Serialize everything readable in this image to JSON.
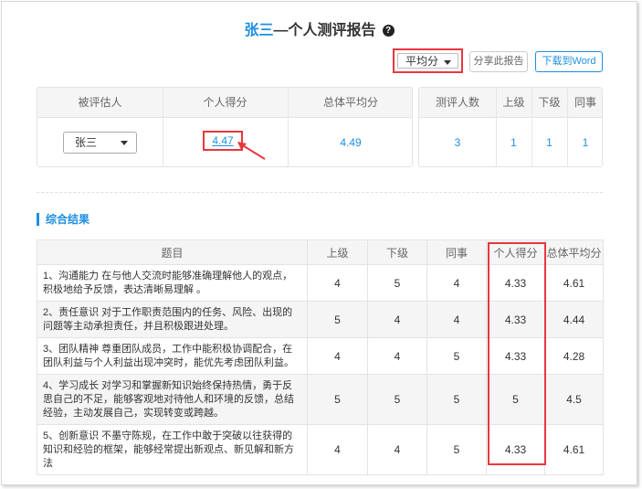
{
  "header": {
    "name": "张三",
    "title_suffix": "—个人测评报告",
    "help_icon": "question-circle-icon"
  },
  "toolbar": {
    "avg_select_value": "平均分",
    "share_label": "分享此报告",
    "download_label": "下载到Word"
  },
  "summary": {
    "headers": [
      "被评估人",
      "个人得分",
      "总体平均分"
    ],
    "person": "张三",
    "personal_score": "4.47",
    "overall_avg": "4.49"
  },
  "counts": {
    "headers": [
      "测评人数",
      "上级",
      "下级",
      "同事"
    ],
    "values": [
      "3",
      "1",
      "1",
      "1"
    ]
  },
  "results": {
    "section_title": "综合结果",
    "headers": [
      "题目",
      "上级",
      "下级",
      "同事",
      "个人得分",
      "总体平均分"
    ],
    "rows": [
      {
        "q": "1、沟通能力 在与他人交流时能够准确理解他人的观点，积极地给予反馈，表达清晰易理解 。",
        "sup": "4",
        "sub": "5",
        "peer": "4",
        "personal": "4.33",
        "avg": "4.61"
      },
      {
        "q": "2、责任意识 对于工作职责范围内的任务、风险、出现的问题等主动承担责任，并且积极跟进处理。",
        "sup": "5",
        "sub": "4",
        "peer": "4",
        "personal": "4.33",
        "avg": "4.44"
      },
      {
        "q": "3、团队精神 尊重团队成员，工作中能积极协调配合，在团队利益与个人利益出现冲突时，能优先考虑团队利益。",
        "sup": "4",
        "sub": "4",
        "peer": "5",
        "personal": "4.33",
        "avg": "4.28"
      },
      {
        "q": "4、学习成长 对学习和掌握新知识始终保持热情，勇于反思自己的不足，能够客观地对待他人和环境的反馈，总结经验，主动发展自己，实现转变或跨越。",
        "sup": "5",
        "sub": "5",
        "peer": "5",
        "personal": "5",
        "avg": "4.5"
      },
      {
        "q": "5、创新意识 不墨守陈规，在工作中敢于突破以往获得的知识和经验的框架，能够经常提出新观点、新见解和新方法",
        "sup": "4",
        "sub": "4",
        "peer": "5",
        "personal": "4.33",
        "avg": "4.61"
      }
    ]
  },
  "colors": {
    "accent": "#1e8fe1",
    "highlight_red": "#e8373d",
    "header_bg": "#f5f5f5"
  }
}
